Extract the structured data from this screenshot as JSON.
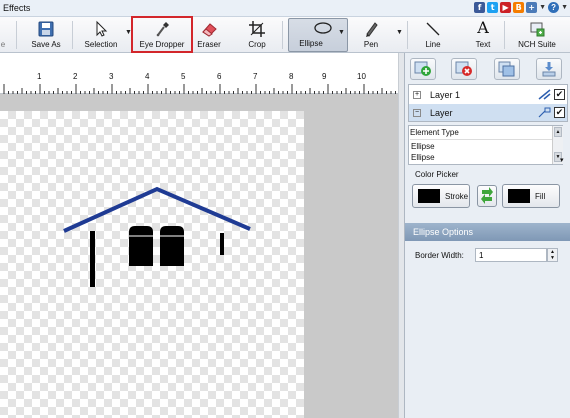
{
  "menubar": {
    "menu_label": "Effects",
    "social_icons": [
      {
        "name": "facebook-icon",
        "glyph": "f",
        "color": "#3b5998"
      },
      {
        "name": "twitter-icon",
        "glyph": "t",
        "color": "#1da1f2"
      },
      {
        "name": "youtube-icon",
        "glyph": "▶",
        "color": "#cc2127"
      },
      {
        "name": "blogger-icon",
        "glyph": "B",
        "color": "#f57d00"
      },
      {
        "name": "share-icon",
        "glyph": "+",
        "color": "#4c7bb8"
      }
    ]
  },
  "toolbar": {
    "buttons": [
      {
        "id": "save",
        "label": "e"
      },
      {
        "id": "save-as",
        "label": "Save As"
      },
      {
        "id": "selection",
        "label": "Selection"
      },
      {
        "id": "eye-dropper",
        "label": "Eye Dropper"
      },
      {
        "id": "eraser",
        "label": "Eraser"
      },
      {
        "id": "crop",
        "label": "Crop"
      },
      {
        "id": "ellipse",
        "label": "Ellipse"
      },
      {
        "id": "pen",
        "label": "Pen"
      },
      {
        "id": "line",
        "label": "Line"
      },
      {
        "id": "text",
        "label": "Text"
      },
      {
        "id": "nch-suite",
        "label": "NCH Suite"
      }
    ],
    "text_glyph": "A",
    "highlight_color": "#d3262b"
  },
  "ruler": {
    "ticks": [
      "1",
      "2",
      "3",
      "4",
      "5",
      "6",
      "7",
      "8",
      "9",
      "10"
    ]
  },
  "layers": {
    "items": [
      {
        "name": "Layer 1",
        "expander": "+",
        "visible_check": "✔"
      },
      {
        "name": "Layer",
        "expander": "−",
        "visible_check": "✔"
      }
    ]
  },
  "element_table": {
    "header": "Element Type",
    "rows": [
      "Ellipse",
      "Ellipse"
    ]
  },
  "color_picker": {
    "title": "Color Picker",
    "stroke_label": "Stroke",
    "fill_label": "Fill",
    "stroke_color": "#000000",
    "fill_color": "#000000"
  },
  "ellipse_options": {
    "title": "Ellipse Options",
    "border_width_label": "Border Width:",
    "border_width_value": "1"
  },
  "colors": {
    "roof_blue": "#1f3b94",
    "drawing_black": "#000000"
  }
}
